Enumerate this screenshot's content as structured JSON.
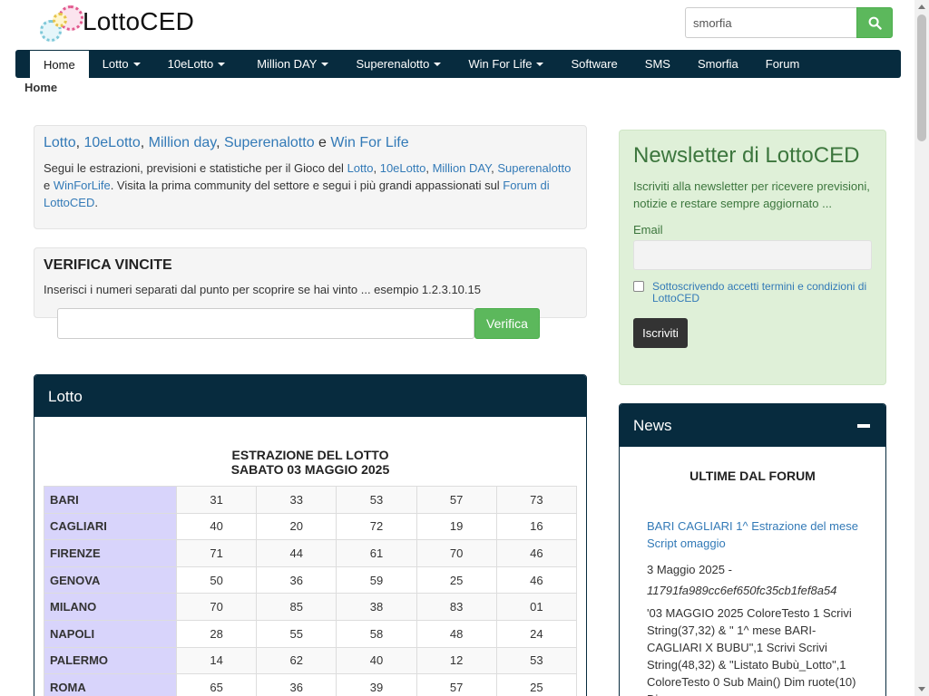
{
  "header": {
    "logo_text": "LottoCED",
    "search_value": "smorfia",
    "search_icon": "magnifier"
  },
  "nav": {
    "items": [
      {
        "label": "Home",
        "active": true,
        "dropdown": false
      },
      {
        "label": "Lotto",
        "dropdown": true
      },
      {
        "label": "10eLotto",
        "dropdown": true
      },
      {
        "label": "Million DAY",
        "dropdown": true
      },
      {
        "label": "Superenalotto",
        "dropdown": true
      },
      {
        "label": "Win For Life",
        "dropdown": true
      },
      {
        "label": "Software",
        "dropdown": false
      },
      {
        "label": "SMS",
        "dropdown": false
      },
      {
        "label": "Smorfia",
        "dropdown": false
      },
      {
        "label": "Forum",
        "dropdown": false
      }
    ]
  },
  "breadcrumb": "Home",
  "intro": {
    "title_links": [
      "Lotto",
      "10eLotto",
      "Million day",
      "Superenalotto",
      "Win For Life"
    ],
    "title_sep": ", ",
    "title_and": " e ",
    "text_1": "Segui le estrazioni, previsioni e statistiche per il Gioco del ",
    "text_links": [
      "Lotto",
      "10eLotto",
      "Million DAY",
      "Superenalotto",
      "WinForLife"
    ],
    "text_and": " e ",
    "text_2": ". Visita la prima community del settore e segui i più grandi appassionati sul ",
    "forum_link": "Forum di LottoCED",
    "text_end": "."
  },
  "verify": {
    "title": "VERIFICA VINCITE",
    "text": "Inserisci i numeri separati dal punto per scoprire se hai vinto ... esempio 1.2.3.10.15",
    "button": "Verifica"
  },
  "lotto": {
    "header": "Lotto",
    "caption_line1": "ESTRAZIONE DEL LOTTO",
    "caption_line2": "SABATO 03 MAGGIO 2025",
    "rows": [
      {
        "city": "BARI",
        "nums": [
          "31",
          "33",
          "53",
          "57",
          "73"
        ]
      },
      {
        "city": "CAGLIARI",
        "nums": [
          "40",
          "20",
          "72",
          "19",
          "16"
        ]
      },
      {
        "city": "FIRENZE",
        "nums": [
          "71",
          "44",
          "61",
          "70",
          "46"
        ]
      },
      {
        "city": "GENOVA",
        "nums": [
          "50",
          "36",
          "59",
          "25",
          "46"
        ]
      },
      {
        "city": "MILANO",
        "nums": [
          "70",
          "85",
          "38",
          "83",
          "01"
        ]
      },
      {
        "city": "NAPOLI",
        "nums": [
          "28",
          "55",
          "58",
          "48",
          "24"
        ]
      },
      {
        "city": "PALERMO",
        "nums": [
          "14",
          "62",
          "40",
          "12",
          "53"
        ]
      },
      {
        "city": "ROMA",
        "nums": [
          "65",
          "36",
          "39",
          "57",
          "25"
        ]
      }
    ]
  },
  "newsletter": {
    "title": "Newsletter di LottoCED",
    "description": "Iscriviti alla newsletter per ricevere previsioni, notizie e restare sempre aggiornato ...",
    "email_label": "Email",
    "consent": "Sottoscrivendo accetti termini e condizioni di LottoCED",
    "button": "Iscriviti"
  },
  "news": {
    "header": "News",
    "subtitle": "ULTIME DAL FORUM",
    "link": "BARI CAGLIARI 1^ Estrazione del mese Script omaggio",
    "date": "3 Maggio 2025 -",
    "hash": "11791fa989cc6ef650fc35cb1fef8a54",
    "excerpt": "'03 MAGGIO 2025 ColoreTesto 1 Scrivi String(37,32) & \" 1^ mese BARI-CAGLIARI X BUBU\",1 Scrivi Scrivi String(48,32) & \"Listato Bubù_Lotto\",1 ColoreTesto 0 Sub Main() Dim ruote(10) Dim"
  }
}
